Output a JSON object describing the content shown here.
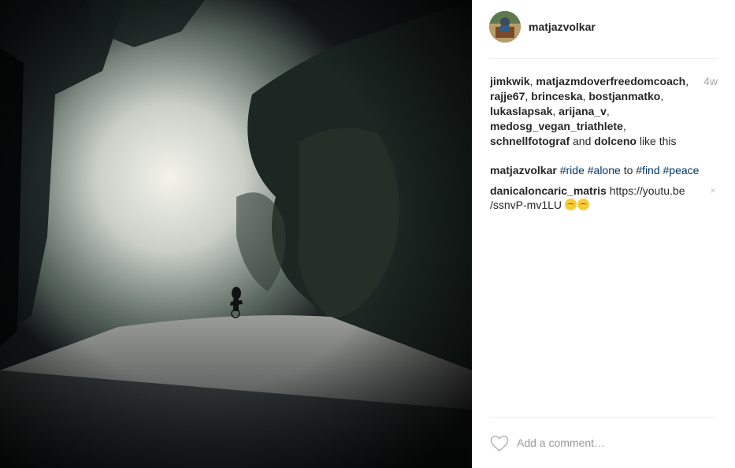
{
  "post": {
    "author": "matjazvolkar",
    "time_ago": "4w"
  },
  "likes": {
    "users": [
      "jimkwik",
      "matjazmdoverfreedomcoach",
      "rajje67",
      "brinceska",
      "bostjanmatko",
      "lukaslapsak",
      "arijana_v",
      "medosg_vegan_triathlete",
      "schnellfotograf"
    ],
    "and_word": "and",
    "last_user": "dolceno",
    "suffix": "like this"
  },
  "caption": {
    "user": "matjazvolkar",
    "tag1": "#ride",
    "tag2": "#alone",
    "to_word": "to",
    "tag3": "#find",
    "tag4": "#peace"
  },
  "comment": {
    "user": "danicaloncaric_matris",
    "text": "https://youtu.be /ssnvP-mv1LU",
    "delete_glyph": "×",
    "emoji_icon": "relieved-face-emoji"
  },
  "add_comment": {
    "placeholder": "Add a comment…"
  },
  "colors": {
    "username": "#262626",
    "hashtag": "#003569",
    "muted": "#a5a7aa",
    "divider": "#efefef"
  }
}
